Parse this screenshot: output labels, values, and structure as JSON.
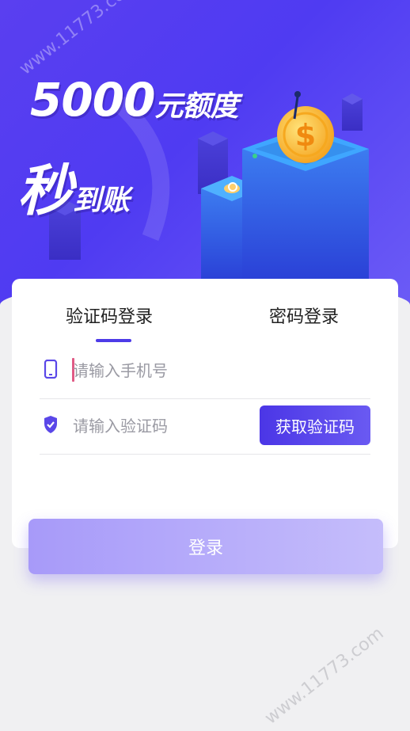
{
  "banner": {
    "headline_number": "5000",
    "headline_suffix": "元额度",
    "sub_big": "秒",
    "sub_small": "到账",
    "watermark": "www.11773.com"
  },
  "tabs": [
    {
      "label": "验证码登录",
      "active": true
    },
    {
      "label": "密码登录",
      "active": false
    }
  ],
  "form": {
    "phone_placeholder": "请输入手机号",
    "code_placeholder": "请输入验证码",
    "get_code_label": "获取验证码"
  },
  "login_label": "登录",
  "colors": {
    "brand": "#4d3be8",
    "login_button": "#b3a8fa",
    "caret": "#e05a85"
  },
  "icons": {
    "phone": "phone-icon",
    "shield": "shield-check-icon"
  }
}
